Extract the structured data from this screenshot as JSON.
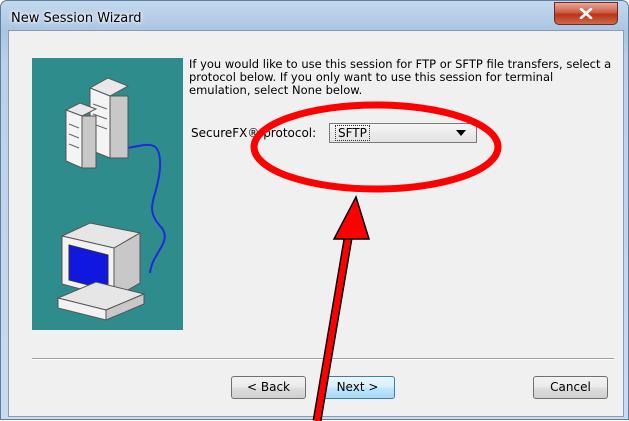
{
  "window": {
    "title": "New Session Wizard",
    "close_label": "X"
  },
  "wizard": {
    "description": "If you would like to use this session for FTP or SFTP file transfers, select a protocol below.  If you only want to use this session for terminal emulation, select None below.",
    "protocol_label": "SecureFX® protocol:",
    "protocol_value": "SFTP"
  },
  "buttons": {
    "back": "< Back",
    "next": "Next >",
    "cancel": "Cancel"
  },
  "icons": {
    "close": "close-icon",
    "dropdown": "chevron-down-icon",
    "servers": "server-icon",
    "computer": "computer-icon"
  },
  "annotation": {
    "color": "#ff0000"
  }
}
